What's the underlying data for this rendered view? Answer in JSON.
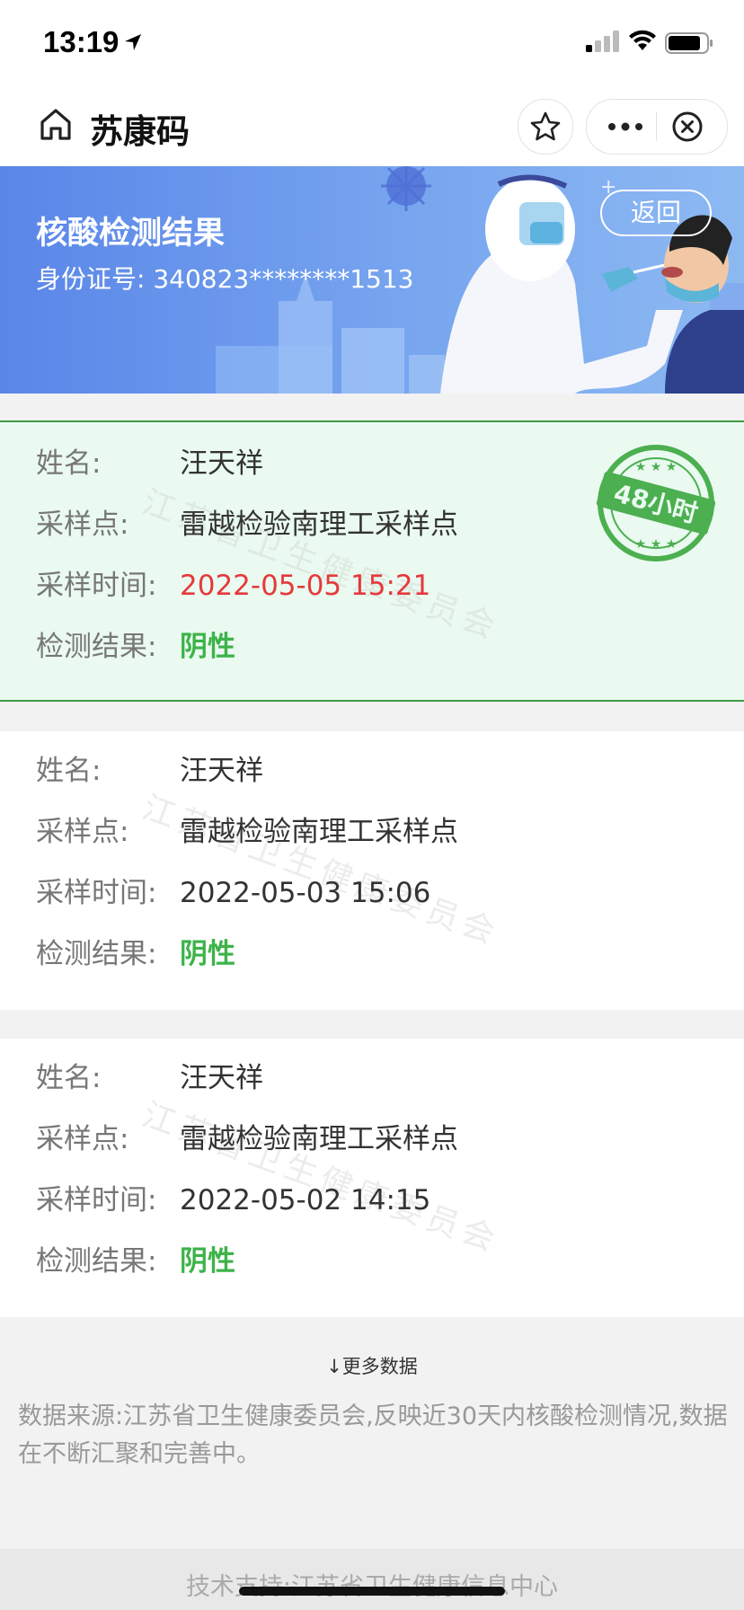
{
  "status_bar": {
    "time": "13:19"
  },
  "navbar": {
    "title": "苏康码"
  },
  "banner": {
    "title": "核酸检测结果",
    "id_label": "身份证号:",
    "id_value": "340823********1513",
    "back_label": "返回"
  },
  "stamp_text": "48小时",
  "watermark": "江苏省卫生健康委员会",
  "labels": {
    "name": "姓名:",
    "site": "采样点:",
    "time": "采样时间:",
    "result": "检测结果:"
  },
  "records": [
    {
      "name": "汪天祥",
      "site": "雷越检验南理工采样点",
      "time": "2022-05-05 15:21",
      "result": "阴性"
    },
    {
      "name": "汪天祥",
      "site": "雷越检验南理工采样点",
      "time": "2022-05-03 15:06",
      "result": "阴性"
    },
    {
      "name": "汪天祥",
      "site": "雷越检验南理工采样点",
      "time": "2022-05-02 14:15",
      "result": "阴性"
    }
  ],
  "more_data": "↓更多数据",
  "source_note": "数据来源:江苏省卫生健康委员会,反映近30天内核酸检测情况,数据在不断汇聚和完善中。",
  "footer": "技术支持:江苏省卫生健康信息中心",
  "colors": {
    "banner": "#5a86e8",
    "accent_red": "#e5393b",
    "result_green": "#3db34a",
    "stamp_green": "#4caf50"
  }
}
